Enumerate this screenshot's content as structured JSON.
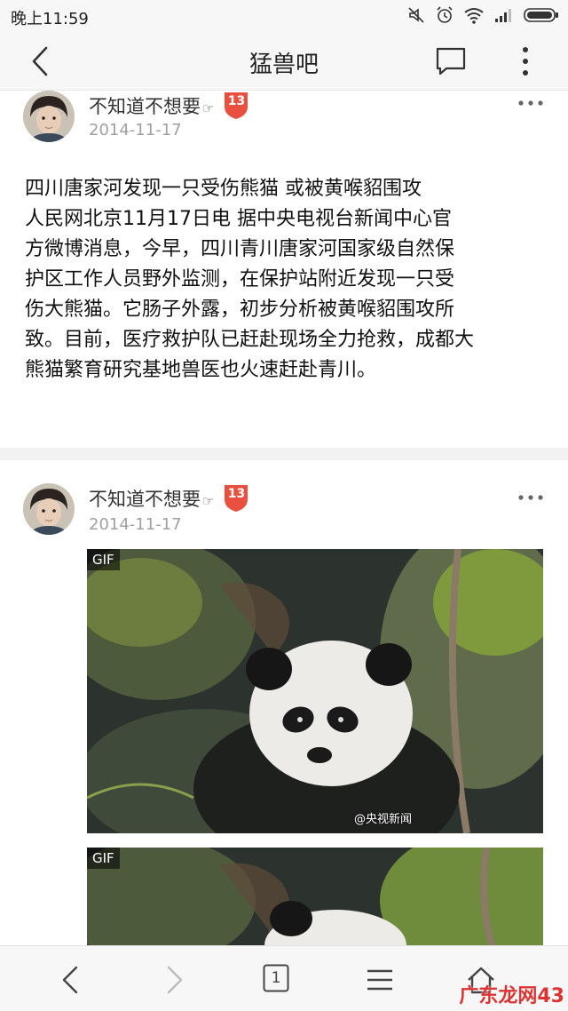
{
  "status_bar": {
    "time": "晚上11:59"
  },
  "header": {
    "title": "猛兽吧",
    "back_icon": "chevron-left-icon",
    "comment_icon": "comment-icon",
    "more_icon": "vertical-dots-icon"
  },
  "posts": [
    {
      "username": "不知道不想要",
      "hand_symbol": "☞",
      "level": "13",
      "date": "2014-11-17",
      "lines": [
        "四川唐家河发现一只受伤熊猫 或被黄喉貂围攻",
        "人民网北京11月17日电 据中央电视台新闻中心官",
        "方微博消息，今早，四川青川唐家河国家级自然保",
        "护区工作人员野外监测，在保护站附近发现一只受",
        "伤大熊猫。它肠子外露，初步分析被黄喉貂围攻所",
        "致。目前，医疗救护队已赶赴现场全力抢救，成都大",
        "熊猫繁育研究基地兽医也火速赶赴青川。"
      ]
    },
    {
      "username": "不知道不想要",
      "hand_symbol": "☞",
      "level": "13",
      "date": "2014-11-17",
      "images": [
        {
          "badge": "GIF",
          "watermark": "@央视新闻"
        },
        {
          "badge": "GIF"
        }
      ]
    }
  ],
  "bottom_nav": {
    "tab_count": "1",
    "corner_watermark": "广东龙网",
    "corner_suffix": "43"
  },
  "colors": {
    "badge": "#e9503f",
    "date": "#a0a0a0",
    "bars": "#f7f7f7"
  }
}
